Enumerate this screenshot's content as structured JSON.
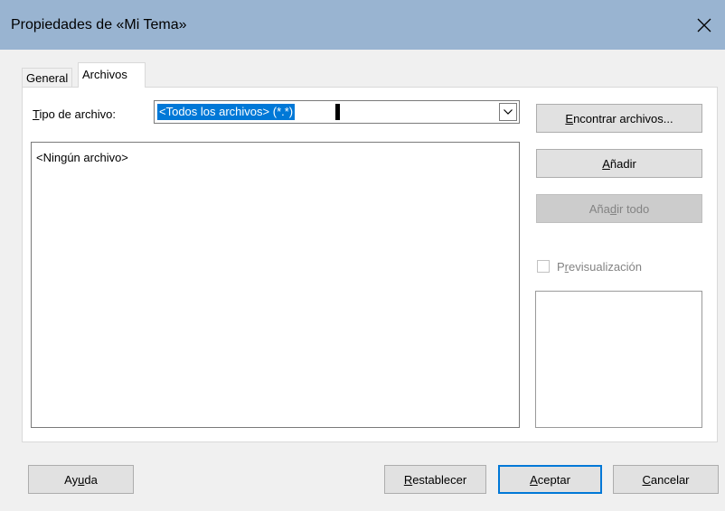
{
  "window": {
    "title": "Propiedades de «Mi Tema»",
    "close_icon": "close-icon"
  },
  "tabs": [
    {
      "label": "General",
      "selected": false
    },
    {
      "label": "Archivos",
      "selected": true
    }
  ],
  "filetype": {
    "label_u": "T",
    "label_rest": "ipo de archivo:",
    "selected_value": "<Todos los archivos> (*.*)",
    "dropdown_icon": "chevron-down-icon"
  },
  "file_list": {
    "empty_text": "<Ningún archivo>"
  },
  "side_buttons": {
    "find": {
      "u": "E",
      "rest": "ncontrar archivos...",
      "enabled": true
    },
    "add": {
      "u": "A",
      "rest": "ñadir",
      "enabled": true
    },
    "add_all": {
      "pre": "Aña",
      "u": "d",
      "rest": "ir todo",
      "enabled": false
    }
  },
  "preview": {
    "pre": "P",
    "u": "r",
    "rest": "evisualización",
    "checked": false,
    "enabled": false
  },
  "footer_buttons": {
    "help": {
      "pre": "Ay",
      "u": "u",
      "rest": "da"
    },
    "reset": {
      "u": "R",
      "rest": "establecer"
    },
    "ok": {
      "u": "A",
      "rest": "ceptar",
      "default": true
    },
    "cancel": {
      "u": "C",
      "rest": "ancelar"
    }
  },
  "colors": {
    "titlebar": "#99b4d1",
    "selection": "#0078d7",
    "default_button_border": "#0078d7"
  }
}
